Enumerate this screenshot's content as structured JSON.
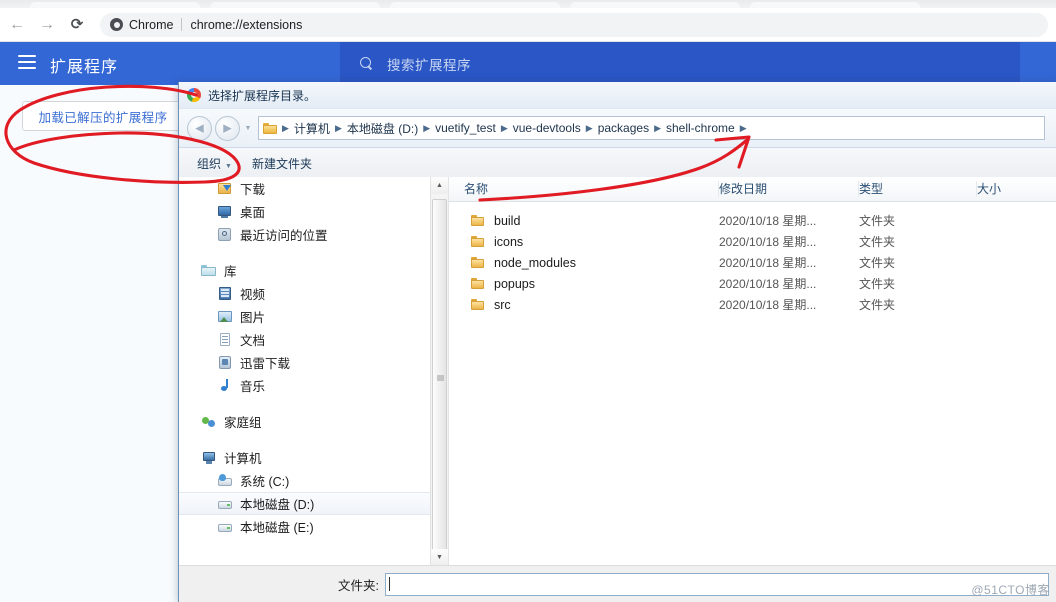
{
  "browser": {
    "nav": {
      "back_icon": "arrow-left-icon",
      "forward_icon": "arrow-right-icon",
      "reload_icon": "reload-icon"
    },
    "omnibox": {
      "chip_label": "Chrome",
      "url": "chrome://extensions"
    }
  },
  "extensions_page": {
    "menu_icon": "hamburger-icon",
    "title": "扩展程序",
    "search": {
      "icon": "search-icon",
      "placeholder": "搜索扩展程序",
      "value": ""
    },
    "load_unpacked_label": "加载已解压的扩展程序"
  },
  "dialog": {
    "icon": "chrome-logo-icon",
    "title": "选择扩展程序目录。",
    "nav": {
      "back_icon": "back-circle-icon",
      "forward_icon": "forward-circle-icon",
      "history_icon": "history-dropdown-icon"
    },
    "address": {
      "folder_icon": "folder-icon",
      "separator": "▶",
      "crumbs": [
        "计算机",
        "本地磁盘 (D:)",
        "vuetify_test",
        "vue-devtools",
        "packages",
        "shell-chrome"
      ]
    },
    "toolbar": {
      "organize_label": "组织",
      "organize_caret": "▼",
      "new_folder_label": "新建文件夹"
    },
    "tree": [
      {
        "label": "下载",
        "icon": "downloads-icon",
        "level": 1,
        "selected": false
      },
      {
        "label": "桌面",
        "icon": "desktop-icon",
        "level": 1,
        "selected": false
      },
      {
        "label": "最近访问的位置",
        "icon": "recent-places-icon",
        "level": 1,
        "selected": false
      },
      {
        "gap": true
      },
      {
        "label": "库",
        "icon": "library-icon",
        "level": 0,
        "selected": false
      },
      {
        "label": "视频",
        "icon": "video-icon",
        "level": 1,
        "selected": false
      },
      {
        "label": "图片",
        "icon": "pictures-icon",
        "level": 1,
        "selected": false
      },
      {
        "label": "文档",
        "icon": "documents-icon",
        "level": 1,
        "selected": false
      },
      {
        "label": "迅雷下载",
        "icon": "xunlei-icon",
        "level": 1,
        "selected": false
      },
      {
        "label": "音乐",
        "icon": "music-icon",
        "level": 1,
        "selected": false
      },
      {
        "gap": true
      },
      {
        "label": "家庭组",
        "icon": "homegroup-icon",
        "level": 0,
        "selected": false
      },
      {
        "gap": true
      },
      {
        "label": "计算机",
        "icon": "computer-icon",
        "level": 0,
        "selected": false
      },
      {
        "label": "系统 (C:)",
        "icon": "system-drive-icon",
        "level": 1,
        "selected": false
      },
      {
        "label": "本地磁盘 (D:)",
        "icon": "drive-icon",
        "level": 1,
        "selected": true
      },
      {
        "label": "本地磁盘 (E:)",
        "icon": "drive-icon",
        "level": 1,
        "selected": false
      }
    ],
    "list": {
      "columns": [
        "名称",
        "修改日期",
        "类型",
        "大小"
      ],
      "rows": [
        {
          "name": "build",
          "date": "2020/10/18 星期...",
          "type": "文件夹",
          "size": ""
        },
        {
          "name": "icons",
          "date": "2020/10/18 星期...",
          "type": "文件夹",
          "size": ""
        },
        {
          "name": "node_modules",
          "date": "2020/10/18 星期...",
          "type": "文件夹",
          "size": ""
        },
        {
          "name": "popups",
          "date": "2020/10/18 星期...",
          "type": "文件夹",
          "size": ""
        },
        {
          "name": "src",
          "date": "2020/10/18 星期...",
          "type": "文件夹",
          "size": ""
        }
      ]
    },
    "footer": {
      "folder_label": "文件夹:",
      "folder_value": ""
    }
  },
  "watermark": "@51CTO博客",
  "colors": {
    "ext_header_blue": "#3367d6",
    "ext_search_blue": "#2a56c6",
    "annotation_red": "#e01b24",
    "load_button_text": "#3b6fd4"
  }
}
